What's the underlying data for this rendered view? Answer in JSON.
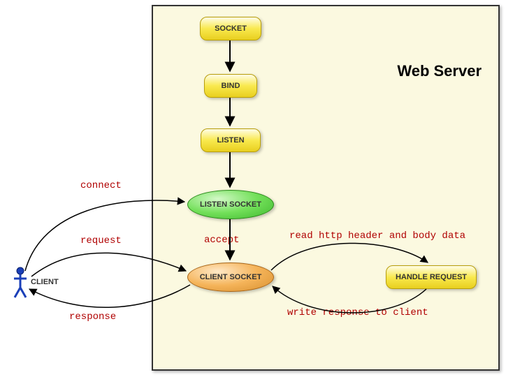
{
  "server": {
    "title": "Web Server"
  },
  "nodes": {
    "socket": "SOCKET",
    "bind": "BIND",
    "listen": "LISTEN",
    "listen_socket": "LISTEN SOCKET",
    "client_socket": "CLIENT SOCKET",
    "handle_request": "HANDLE REQUEST",
    "client": "CLIENT"
  },
  "edges": {
    "connect": "connect",
    "accept": "accept",
    "request": "request",
    "response": "response",
    "read": "read http header and body data",
    "write": "write response to client"
  }
}
